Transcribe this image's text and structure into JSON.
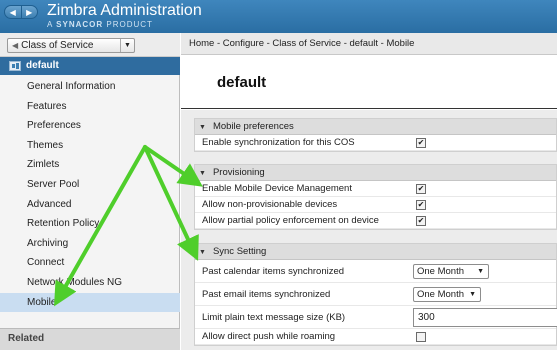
{
  "header": {
    "title": "Zimbra Administration",
    "subtitle_prefix": "A",
    "subtitle_brand": "SYNACOR",
    "subtitle_suffix": "PRODUCT",
    "nav_back": "◀",
    "nav_forward": "▶"
  },
  "sidebar": {
    "selector_value": "Class of Service",
    "selected_cos": "default",
    "items": [
      {
        "label": "General Information"
      },
      {
        "label": "Features"
      },
      {
        "label": "Preferences"
      },
      {
        "label": "Themes"
      },
      {
        "label": "Zimlets"
      },
      {
        "label": "Server Pool"
      },
      {
        "label": "Advanced"
      },
      {
        "label": "Retention Policy"
      },
      {
        "label": "Archiving"
      },
      {
        "label": "Connect"
      },
      {
        "label": "Network Modules NG"
      },
      {
        "label": "Mobile"
      }
    ],
    "related_label": "Related"
  },
  "breadcrumb": "Home - Configure - Class of Service - default - Mobile",
  "page_title": "default",
  "sections": {
    "mobile_prefs": {
      "title": "Mobile preferences",
      "rows": [
        {
          "label": "Enable synchronization for this COS",
          "checked": true
        }
      ]
    },
    "provisioning": {
      "title": "Provisioning",
      "rows": [
        {
          "label": "Enable Mobile Device Management",
          "checked": true
        },
        {
          "label": "Allow non-provisionable devices",
          "checked": true
        },
        {
          "label": "Allow partial policy enforcement on device",
          "checked": true
        }
      ]
    },
    "sync": {
      "title": "Sync Setting",
      "calendar_label": "Past calendar items synchronized",
      "calendar_value": "One Month",
      "email_label": "Past email items synchronized",
      "email_value": "One Month",
      "plaintext_label": "Limit plain text message size (KB)",
      "plaintext_value": "300",
      "push_label": "Allow direct push while roaming",
      "push_checked": false
    }
  },
  "colors": {
    "header": "#2a6ea3",
    "selected_row": "#2f6c9f",
    "active_nav": "#c9ddf1",
    "annotation_arrow": "#4fce2b"
  }
}
